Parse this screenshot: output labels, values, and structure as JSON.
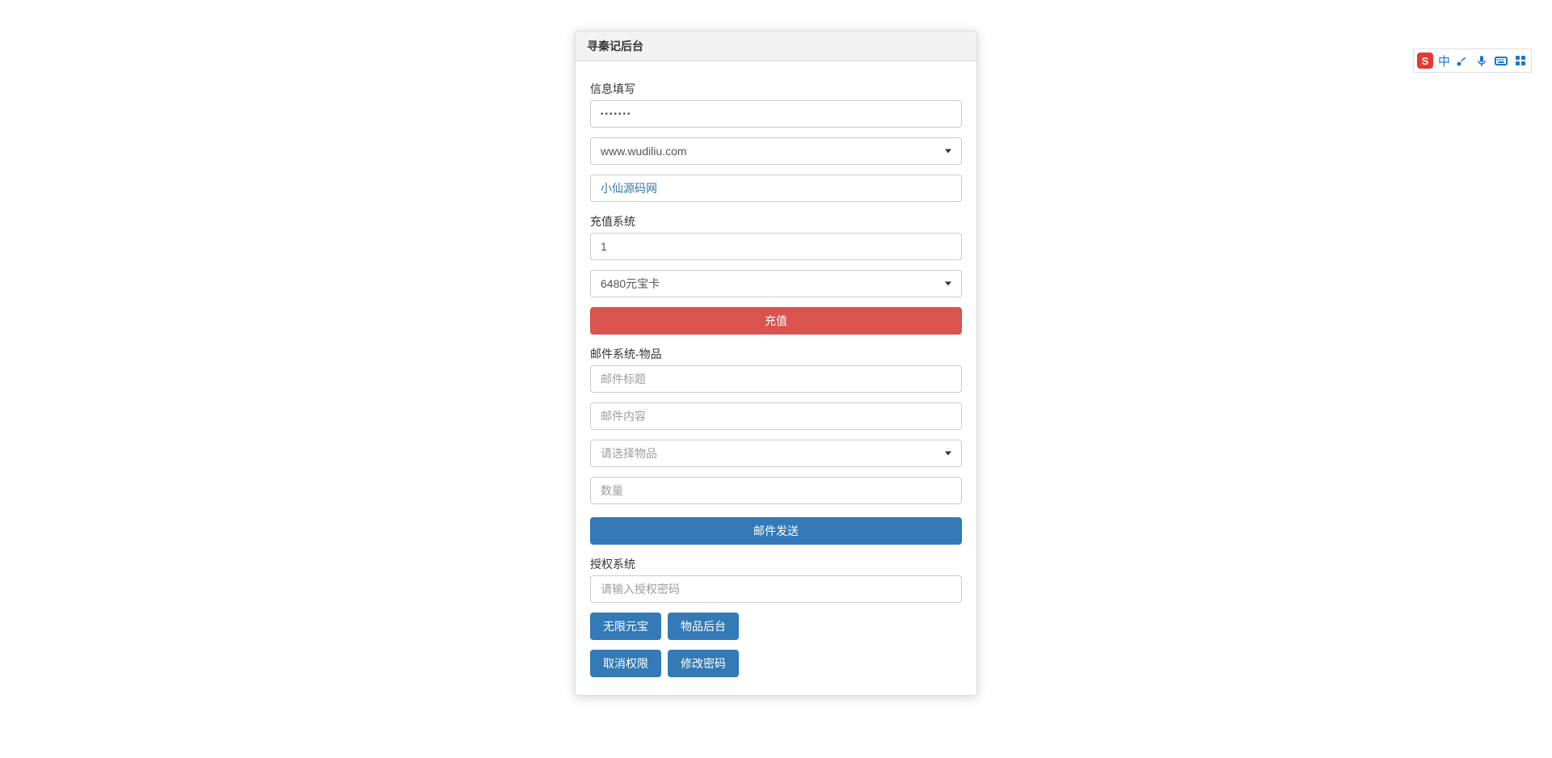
{
  "ime": {
    "lang": "中"
  },
  "panel": {
    "title": "寻秦记后台"
  },
  "info": {
    "label": "信息填写",
    "password_value": "•••••••",
    "server_selected": "www.wudiliu.com",
    "site_name": "小仙源码网"
  },
  "recharge": {
    "label": "充值系统",
    "qty": "1",
    "card_selected": "6480元宝卡",
    "submit": "充值"
  },
  "mail": {
    "label": "邮件系统-物品",
    "title_ph": "邮件标题",
    "content_ph": "邮件内容",
    "item_ph": "请选择物品",
    "qty_ph": "数量",
    "submit": "邮件发送"
  },
  "auth": {
    "label": "授权系统",
    "code_ph": "请输入授权密码",
    "btn_unlimited": "无限元宝",
    "btn_item_admin": "物品后台",
    "btn_revoke": "取消权限",
    "btn_change_pw": "修改密码"
  }
}
